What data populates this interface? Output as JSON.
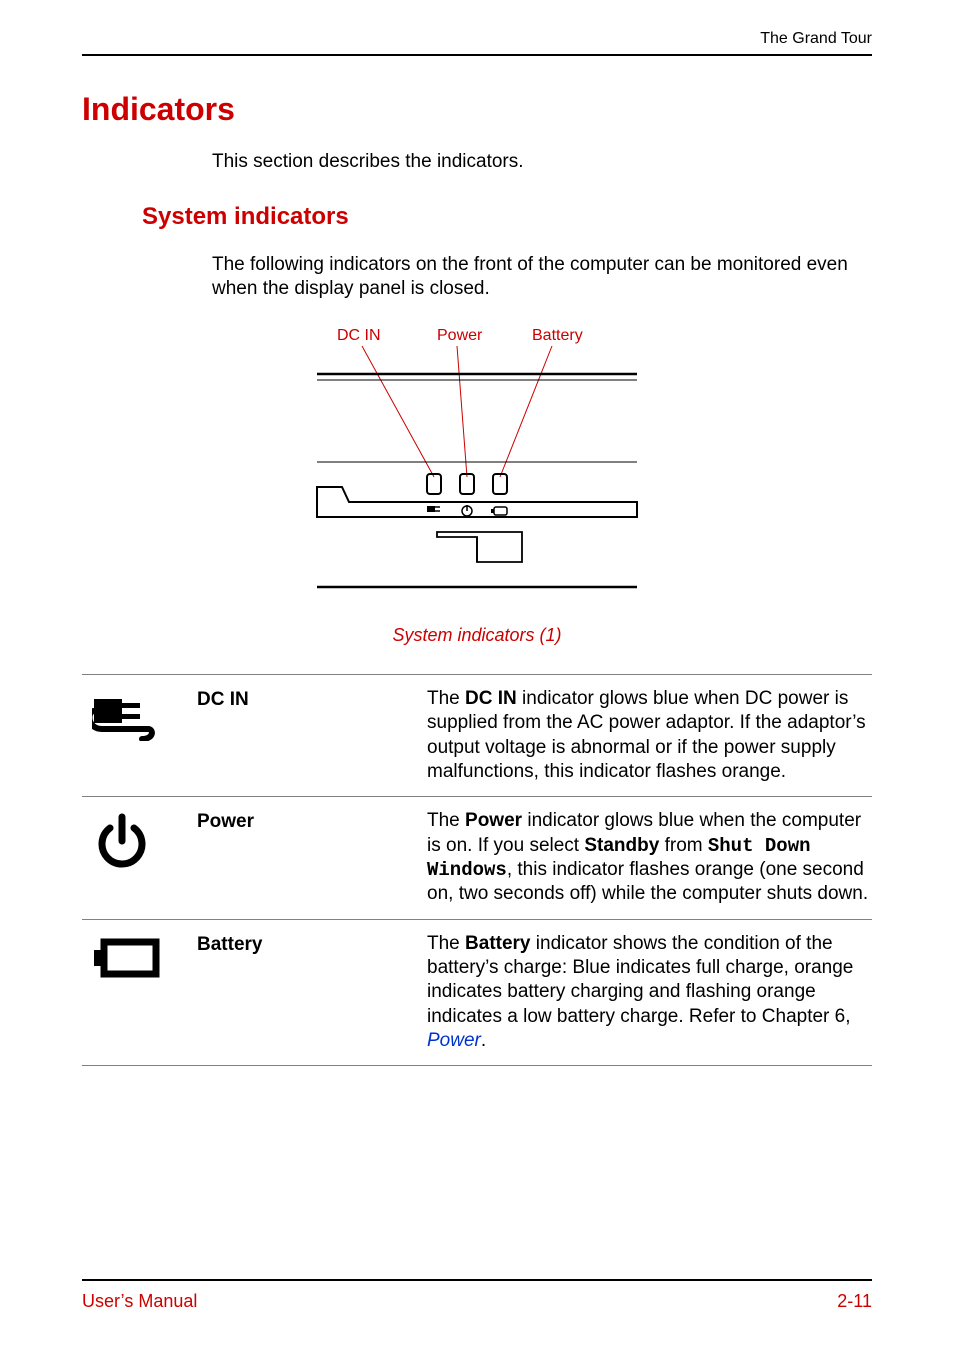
{
  "header": {
    "section": "The Grand Tour"
  },
  "title": "Indicators",
  "intro": "This section describes the indicators.",
  "sub": {
    "title": "System indicators",
    "intro": "The following indicators on the front of the computer can be monitored even when the display panel is closed."
  },
  "figure": {
    "labels": {
      "dcin": "DC IN",
      "power": "Power",
      "battery": "Battery"
    },
    "caption": "System indicators (1)"
  },
  "rows": [
    {
      "icon": "plug-icon",
      "name": "DC IN",
      "desc_pre": "The ",
      "desc_bold1": "DC IN",
      "desc_post": " indicator glows blue when DC power is supplied from the AC power adaptor. If the adaptor’s output voltage is abnormal or if the power supply malfunctions, this indicator flashes orange."
    },
    {
      "icon": "power-icon",
      "name": "Power",
      "desc_pre": "The ",
      "desc_bold1": "Power",
      "desc_mid1": " indicator glows blue when the computer is on. If you select ",
      "desc_bold2": "Standby",
      "desc_mid2": " from ",
      "desc_mono": "Shut Down Windows",
      "desc_post": ", this indicator flashes orange (one second on, two seconds off) while the computer shuts down."
    },
    {
      "icon": "battery-icon",
      "name": "Battery",
      "desc_pre": "The ",
      "desc_bold1": "Battery",
      "desc_mid1": " indicator shows the condition of the battery’s charge: Blue indicates full charge, orange indicates battery charging and flashing orange indicates a low battery charge. Refer to Chapter 6, ",
      "desc_link": "Power",
      "desc_post": "."
    }
  ],
  "footer": {
    "left": "User’s Manual",
    "right": "2-11"
  }
}
